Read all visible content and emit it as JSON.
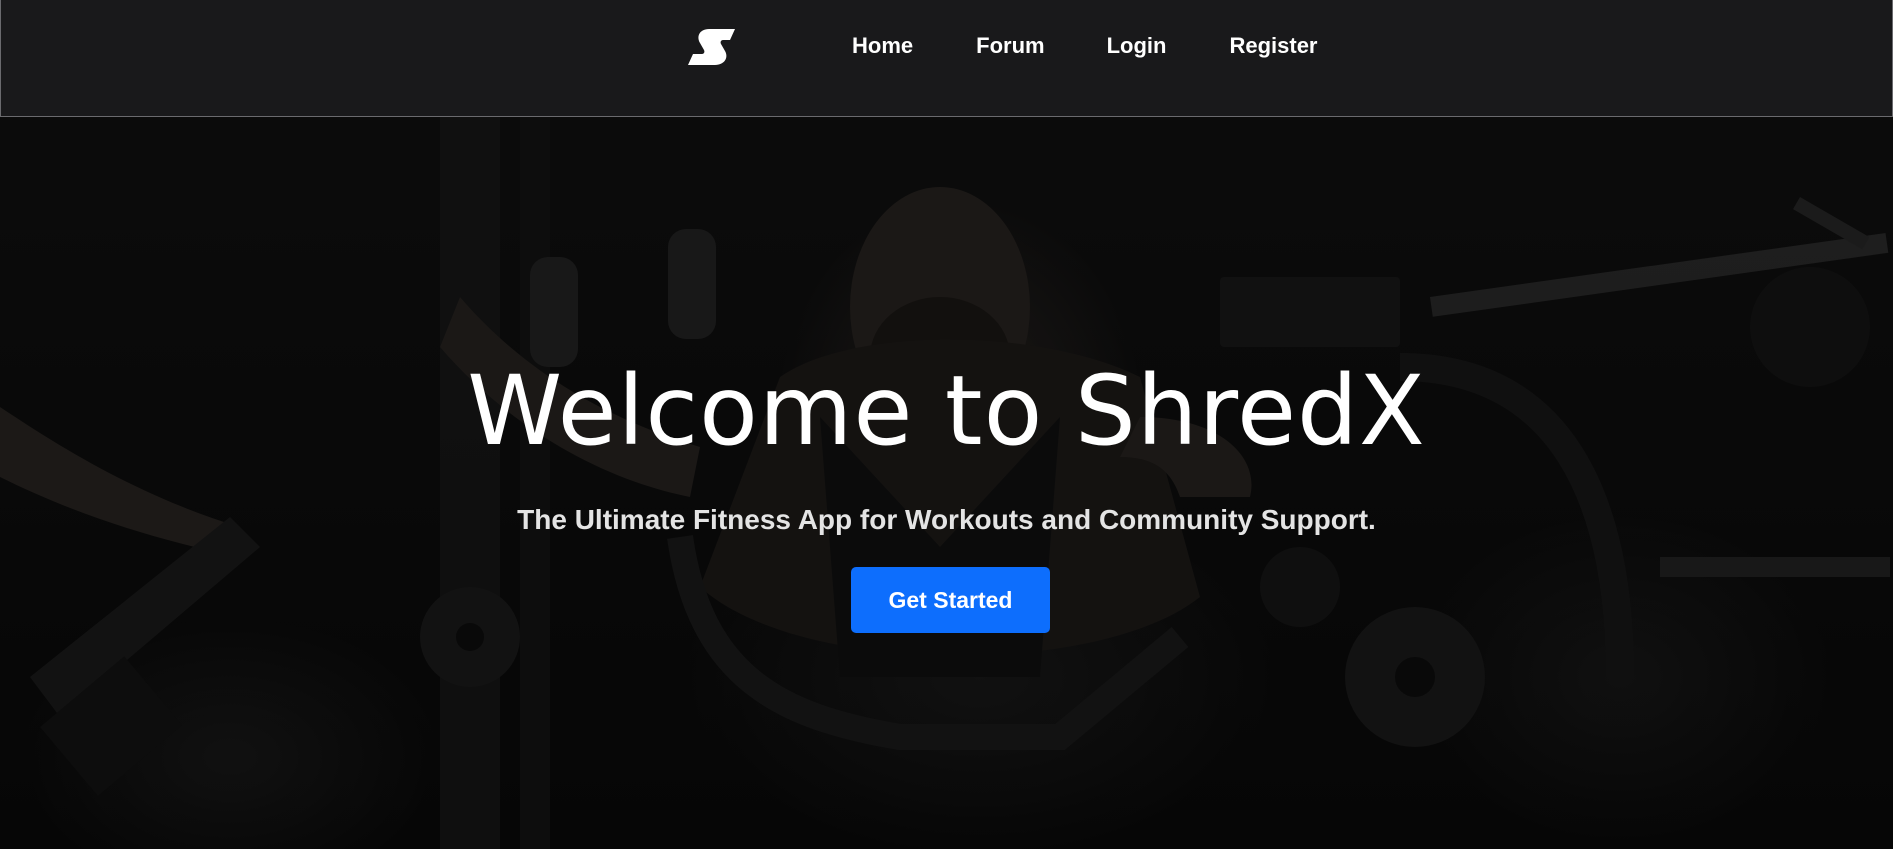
{
  "navbar": {
    "logo_icon": "shredx-s-logo-icon",
    "links": [
      {
        "label": "Home"
      },
      {
        "label": "Forum"
      },
      {
        "label": "Login"
      },
      {
        "label": "Register"
      }
    ]
  },
  "hero": {
    "title": "Welcome to ShredX",
    "subtitle": "The Ultimate Fitness App for Workouts and Community Support.",
    "cta_label": "Get Started",
    "background_image": "gym-athlete-photo"
  },
  "colors": {
    "navbar_bg": "#19191b",
    "cta_bg": "#0d6efd",
    "text": "#ffffff"
  }
}
